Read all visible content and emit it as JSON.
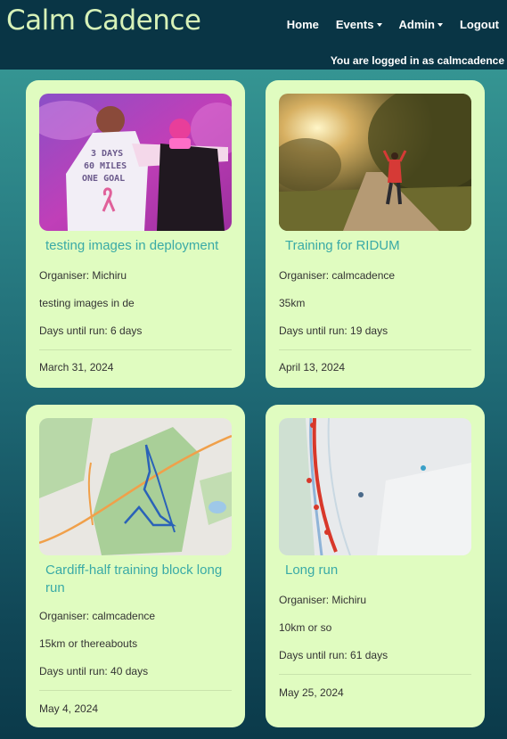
{
  "brand": "Calm Cadence",
  "nav": {
    "home": "Home",
    "events": "Events",
    "admin": "Admin",
    "logout": "Logout"
  },
  "login_status": "You are logged in as calmcadence",
  "colors": {
    "nav_background": "#093545",
    "brand_text": "#d7f2b8",
    "card_background": "#e0fcc0",
    "card_title": "#3aaaa6"
  },
  "cards": [
    {
      "title": "testing images in deployment",
      "organiser": "Organiser: Michiru",
      "description": "testing images in de",
      "days_until": "Days until run: 6 days",
      "date": "March 31, 2024",
      "image_text": [
        "3 DAYS",
        "60 MILES",
        "ONE GOAL"
      ]
    },
    {
      "title": "Training for RIDUM",
      "organiser": "Organiser: calmcadence",
      "description": "35km",
      "days_until": "Days until run: 19 days",
      "date": "April 13, 2024"
    },
    {
      "title": "Cardiff-half training block long run",
      "organiser": "Organiser: calmcadence",
      "description": "15km or thereabouts",
      "days_until": "Days until run: 40 days",
      "date": "May 4, 2024"
    },
    {
      "title": "Long run",
      "organiser": "Organiser: Michiru",
      "description": "10km or so",
      "days_until": "Days until run: 61 days",
      "date": "May 25, 2024"
    }
  ]
}
